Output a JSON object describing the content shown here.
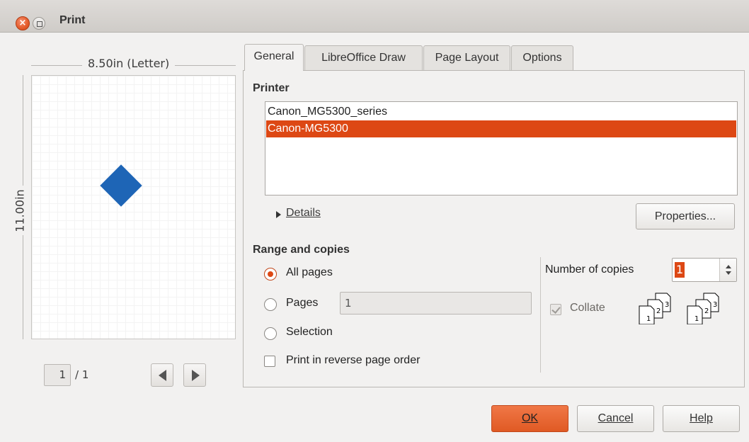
{
  "window": {
    "title": "Print"
  },
  "preview": {
    "paper_width_label": "8.50in (Letter)",
    "paper_height_label": "11.00in",
    "current_page": "1",
    "total_pages": "/ 1",
    "shape_color": "#1e65b6"
  },
  "tabs": [
    {
      "label": "General",
      "active": true
    },
    {
      "label": "LibreOffice Draw",
      "active": false
    },
    {
      "label": "Page Layout",
      "active": false
    },
    {
      "label": "Options",
      "active": false
    }
  ],
  "printer": {
    "section_title": "Printer",
    "printers": [
      "Canon_MG5300_series",
      "Canon-MG5300"
    ],
    "selected_index": 1,
    "details_label": "Details",
    "properties_label": "Properties..."
  },
  "range": {
    "section_title": "Range and copies",
    "all_pages_label": "All pages",
    "pages_label": "Pages",
    "pages_value": "1",
    "selection_label": "Selection",
    "reverse_label": "Print in reverse page order",
    "selected_option": "all_pages"
  },
  "copies": {
    "label": "Number of copies",
    "value": "1",
    "collate_label": "Collate",
    "collate_checked": true
  },
  "buttons": {
    "ok": "OK",
    "cancel": "Cancel",
    "help": "Help"
  },
  "colors": {
    "accent": "#dd4814",
    "dialog_bg": "#f2f1f0"
  }
}
